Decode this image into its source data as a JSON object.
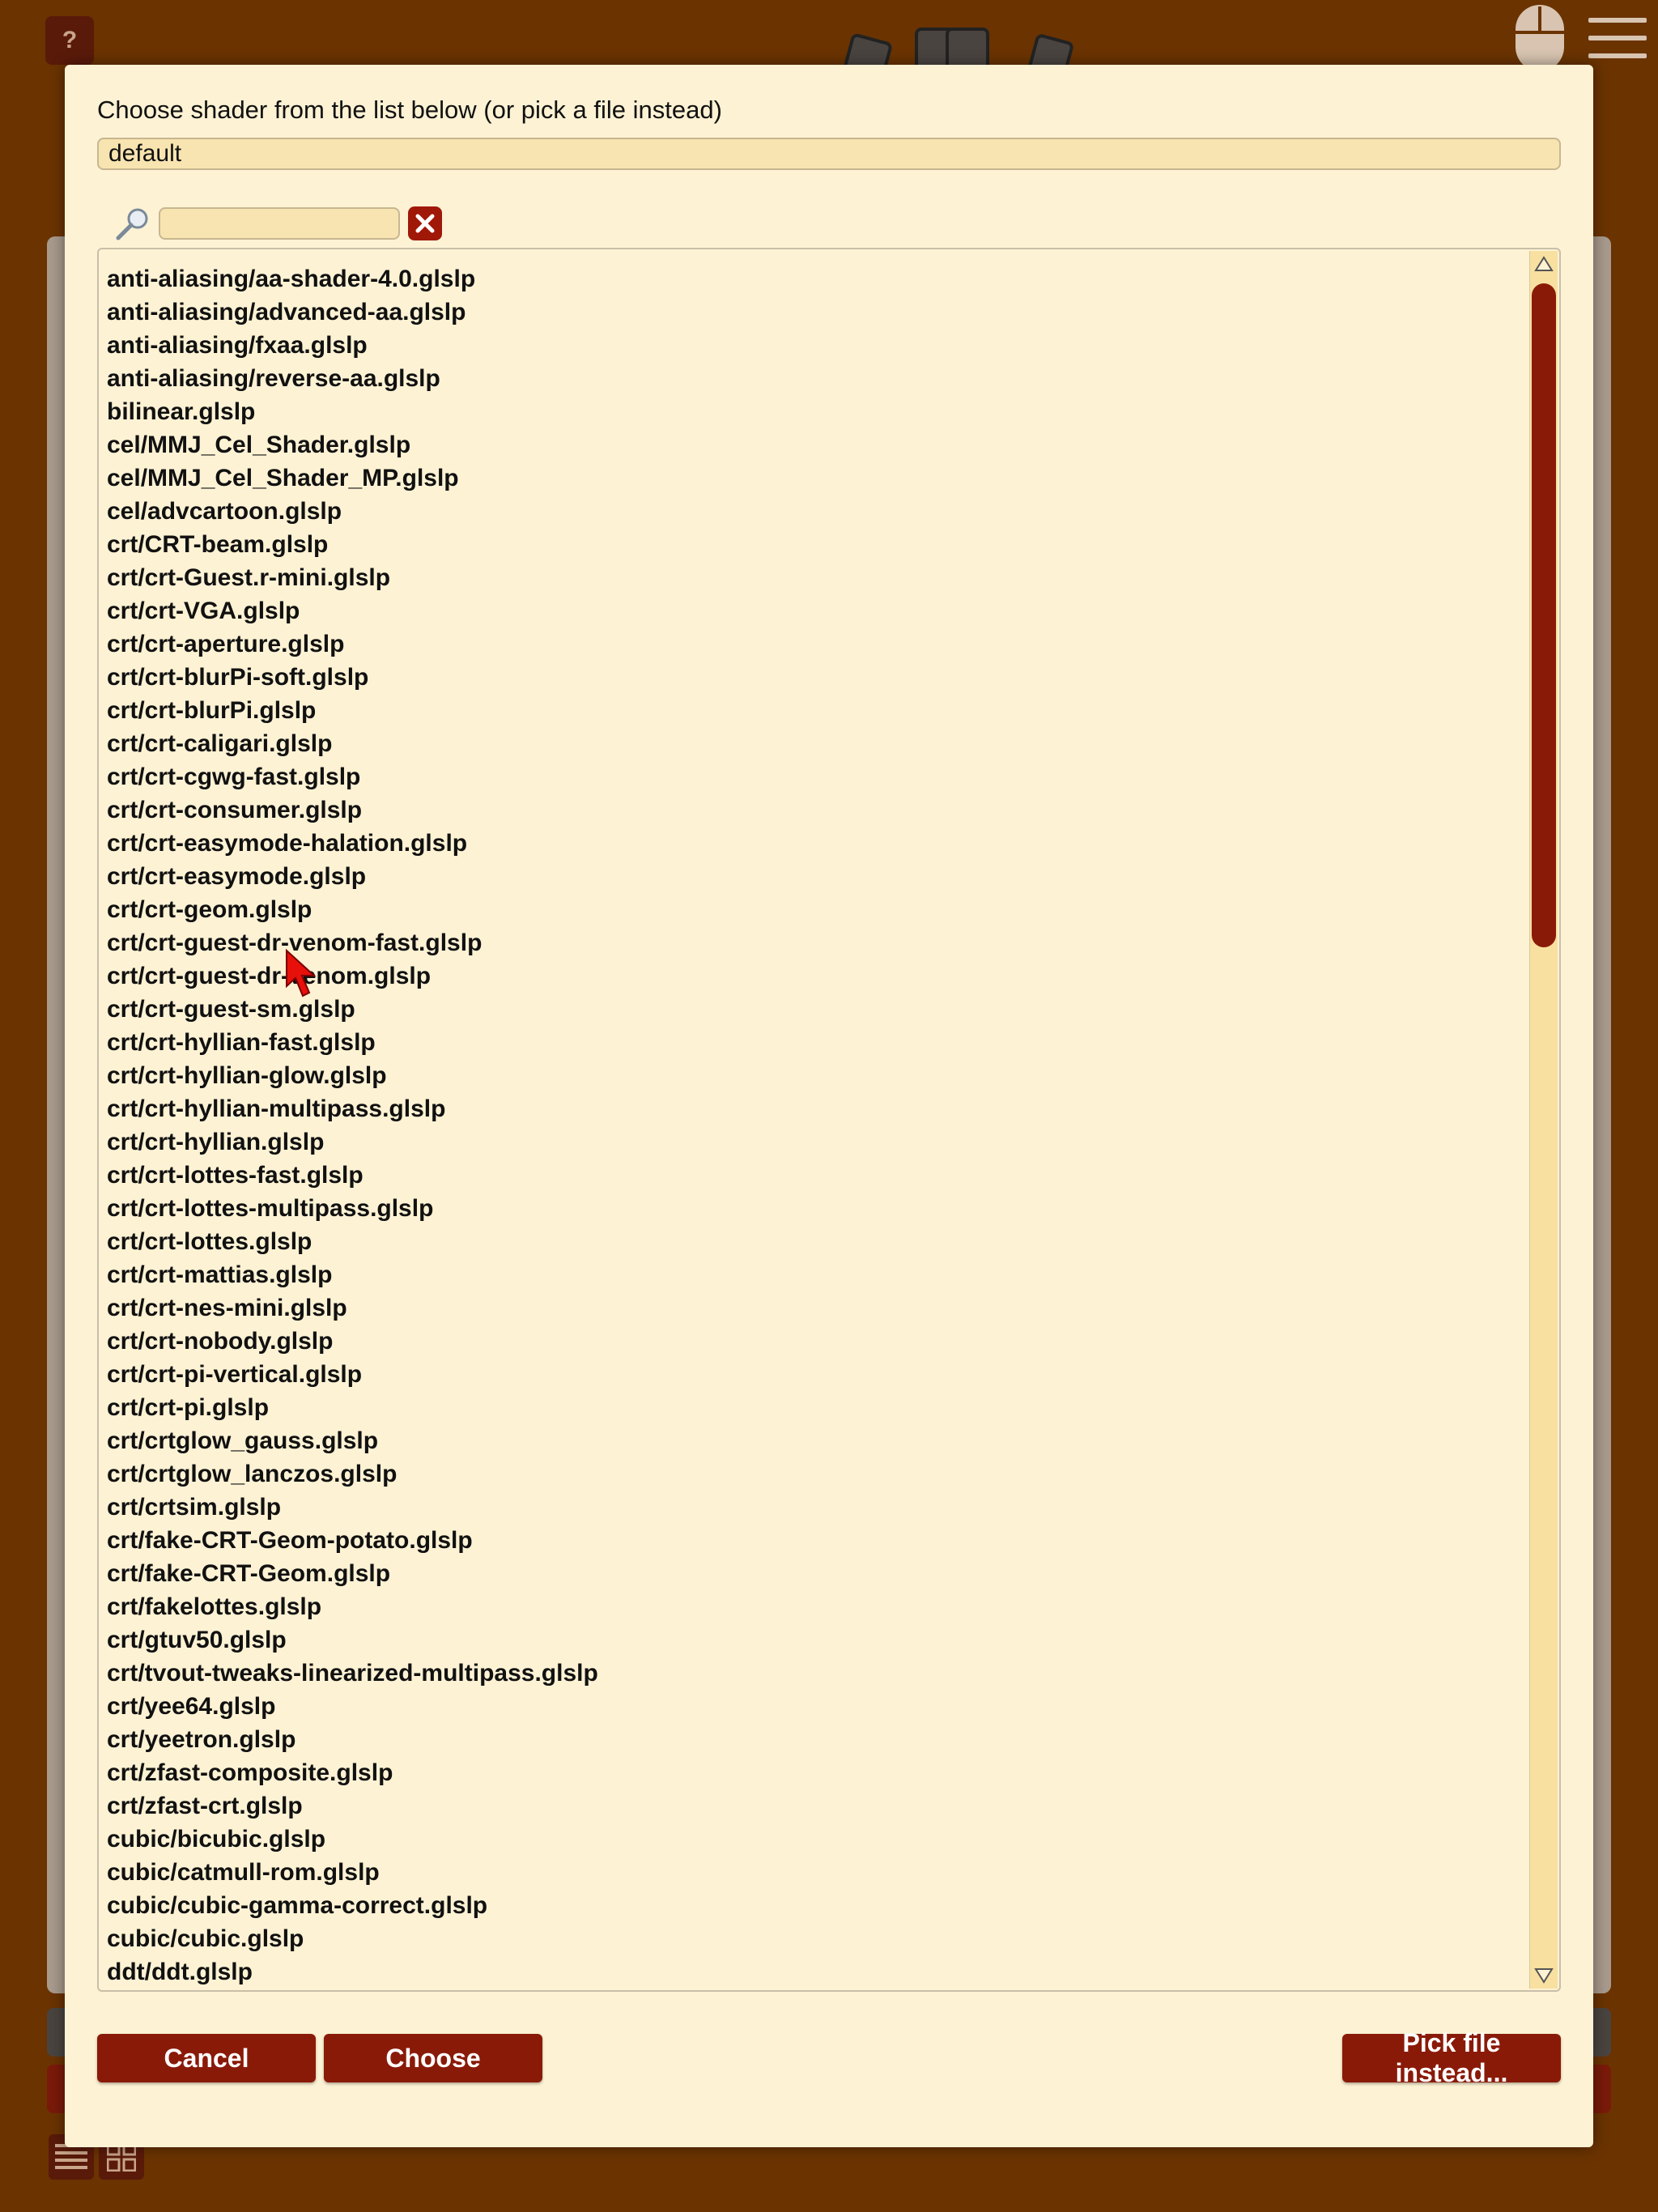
{
  "background": {
    "help_label": "?"
  },
  "modal": {
    "title": "Choose shader from the list below (or pick a file instead)",
    "selected_value": "default",
    "search_value": "",
    "items": [
      "anti-aliasing/aa-shader-4.0.glslp",
      "anti-aliasing/advanced-aa.glslp",
      "anti-aliasing/fxaa.glslp",
      "anti-aliasing/reverse-aa.glslp",
      "bilinear.glslp",
      "cel/MMJ_Cel_Shader.glslp",
      "cel/MMJ_Cel_Shader_MP.glslp",
      "cel/advcartoon.glslp",
      "crt/CRT-beam.glslp",
      "crt/crt-Guest.r-mini.glslp",
      "crt/crt-VGA.glslp",
      "crt/crt-aperture.glslp",
      "crt/crt-blurPi-soft.glslp",
      "crt/crt-blurPi.glslp",
      "crt/crt-caligari.glslp",
      "crt/crt-cgwg-fast.glslp",
      "crt/crt-consumer.glslp",
      "crt/crt-easymode-halation.glslp",
      "crt/crt-easymode.glslp",
      "crt/crt-geom.glslp",
      "crt/crt-guest-dr-venom-fast.glslp",
      "crt/crt-guest-dr-venom.glslp",
      "crt/crt-guest-sm.glslp",
      "crt/crt-hyllian-fast.glslp",
      "crt/crt-hyllian-glow.glslp",
      "crt/crt-hyllian-multipass.glslp",
      "crt/crt-hyllian.glslp",
      "crt/crt-lottes-fast.glslp",
      "crt/crt-lottes-multipass.glslp",
      "crt/crt-lottes.glslp",
      "crt/crt-mattias.glslp",
      "crt/crt-nes-mini.glslp",
      "crt/crt-nobody.glslp",
      "crt/crt-pi-vertical.glslp",
      "crt/crt-pi.glslp",
      "crt/crtglow_gauss.glslp",
      "crt/crtglow_lanczos.glslp",
      "crt/crtsim.glslp",
      "crt/fake-CRT-Geom-potato.glslp",
      "crt/fake-CRT-Geom.glslp",
      "crt/fakelottes.glslp",
      "crt/gtuv50.glslp",
      "crt/tvout-tweaks-linearized-multipass.glslp",
      "crt/yee64.glslp",
      "crt/yeetron.glslp",
      "crt/zfast-composite.glslp",
      "crt/zfast-crt.glslp",
      "cubic/bicubic.glslp",
      "cubic/catmull-rom.glslp",
      "cubic/cubic-gamma-correct.glslp",
      "cubic/cubic.glslp",
      "ddt/ddt.glslp"
    ],
    "buttons": {
      "cancel": "Cancel",
      "choose": "Choose",
      "pick_file": "Pick file instead..."
    }
  },
  "colors": {
    "accent": "#8a1a08",
    "modal_bg": "#fdf2d4",
    "field_bg": "#f8e4b0",
    "page_bg": "#6b3300"
  }
}
